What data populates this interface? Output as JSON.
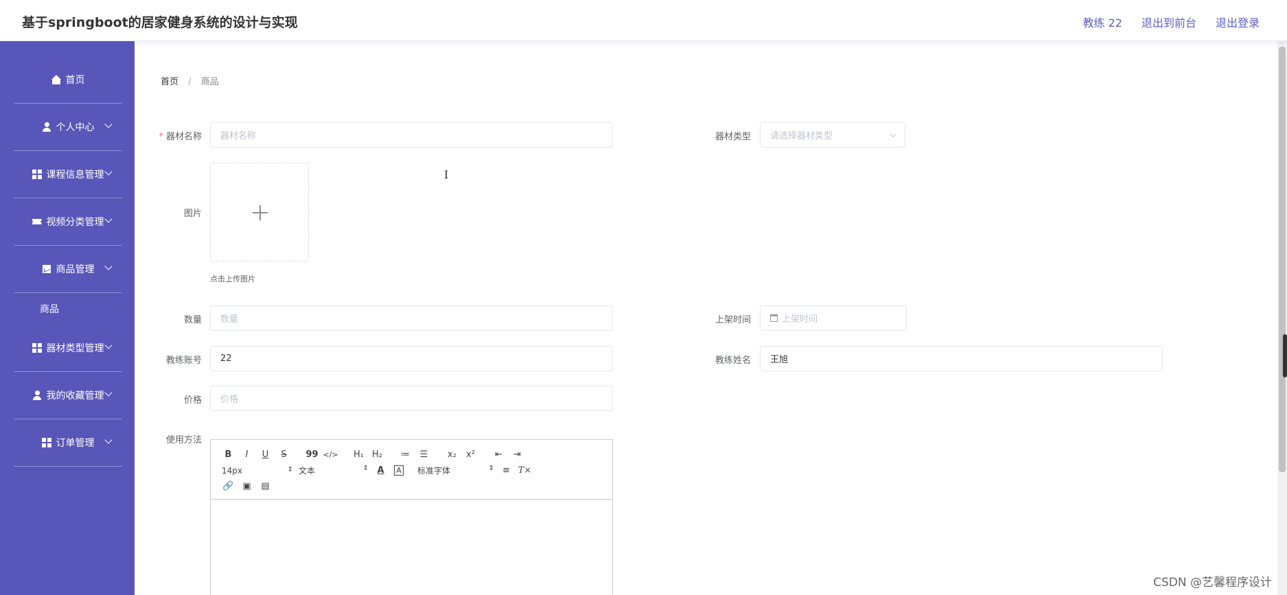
{
  "header": {
    "title": "基于springboot的居家健身系统的设计与实现",
    "user_label": "教练 22",
    "back_label": "退出到前台",
    "logout_label": "退出登录"
  },
  "sidebar": {
    "items": [
      {
        "label": "首页",
        "icon": "home-icon"
      },
      {
        "label": "个人中心",
        "icon": "user-icon"
      },
      {
        "label": "课程信息管理",
        "icon": "grid-icon"
      },
      {
        "label": "视频分类管理",
        "icon": "ticket-icon"
      },
      {
        "label": "商品管理",
        "icon": "chart-icon",
        "children": [
          "商品"
        ]
      },
      {
        "label": "器材类型管理",
        "icon": "grid-icon"
      },
      {
        "label": "我的收藏管理",
        "icon": "user-icon"
      },
      {
        "label": "订单管理",
        "icon": "grid-icon"
      }
    ]
  },
  "breadcrumb": {
    "home": "首页",
    "separator": "/",
    "current": "商品"
  },
  "form": {
    "name": {
      "label": "器材名称",
      "placeholder": "器材名称"
    },
    "type": {
      "label": "器材类型",
      "placeholder": "请选择器材类型"
    },
    "image": {
      "label": "图片",
      "tip": "点击上传图片"
    },
    "quantity": {
      "label": "数量",
      "placeholder": "数量"
    },
    "listing_time": {
      "label": "上架时间",
      "placeholder": "上架时间"
    },
    "coach_account": {
      "label": "教练账号",
      "value": "22"
    },
    "coach_name": {
      "label": "教练姓名",
      "value": "王旭"
    },
    "price": {
      "label": "价格",
      "placeholder": "价格"
    },
    "usage": {
      "label": "使用方法"
    }
  },
  "editor": {
    "row1": [
      "B",
      "I",
      "U",
      "S",
      "99",
      "</>",
      "H₁",
      "H₂",
      "≔",
      "☰",
      "x₂",
      "x²",
      "⇤",
      "⇥"
    ],
    "size": "14px",
    "header": "文本",
    "font": "标准字体",
    "row3": [
      "🔗",
      "▣",
      "▤"
    ]
  },
  "watermark": "CSDN @艺馨程序设计"
}
